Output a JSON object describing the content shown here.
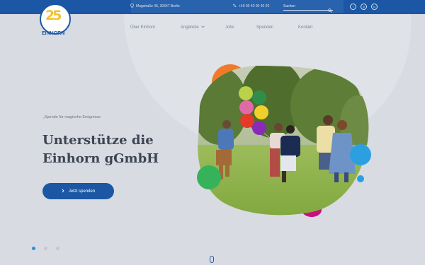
{
  "topbar": {
    "address": "Magstraße 45, 30347 Berlin",
    "phone": "+49 30 40 00 40 20",
    "search_placeholder": "Suchen",
    "socials": [
      {
        "icon": "facebook-icon",
        "glyph": "f"
      },
      {
        "icon": "instagram-icon",
        "glyph": "◎"
      },
      {
        "icon": "linkedin-icon",
        "glyph": "in"
      }
    ]
  },
  "logo": {
    "number": "25",
    "text": "EINHORN"
  },
  "nav": {
    "items": [
      "Über Einhorn",
      "Angebote",
      "Jobs",
      "Spenden",
      "Kontakt"
    ]
  },
  "hero": {
    "kicker": "„Spende für magische Ereignisse",
    "headline_line1": "Unterstütze die",
    "headline_line2": "Einhorn gGmbH",
    "cta_label": "Jetzt spenden"
  },
  "slider": {
    "slide_count": 3,
    "active_slide": 1
  },
  "colors": {
    "brand_blue": "#1b57a4",
    "accent_orange": "#f07a2a",
    "accent_green": "#36b25a",
    "accent_magenta": "#c8107a",
    "accent_cyan": "#2c9fe0",
    "background": "#d8dbe1"
  }
}
